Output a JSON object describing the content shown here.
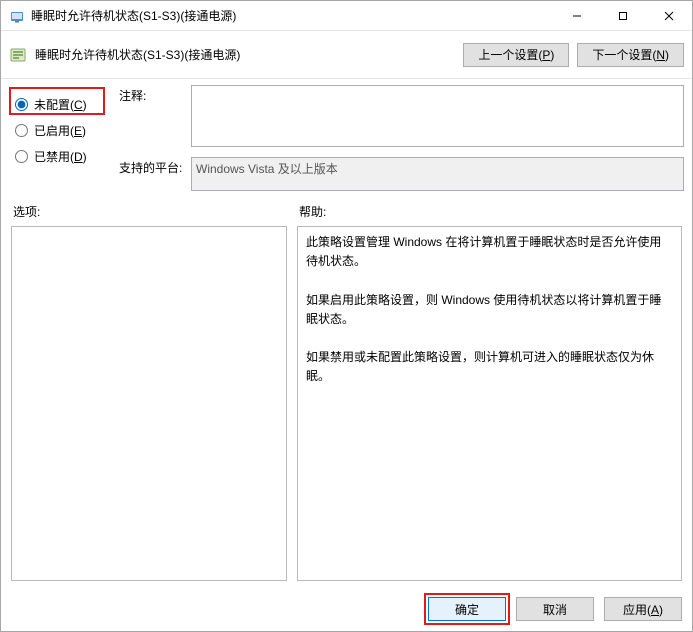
{
  "window": {
    "title": "睡眠时允许待机状态(S1-S3)(接通电源)"
  },
  "header": {
    "policy_title": "睡眠时允许待机状态(S1-S3)(接通电源)",
    "prev_label_pre": "上一个设置(",
    "prev_label_key": "P",
    "prev_label_post": ")",
    "next_label_pre": "下一个设置(",
    "next_label_key": "N",
    "next_label_post": ")"
  },
  "radios": {
    "not_configured_pre": "未配置(",
    "not_configured_key": "C",
    "not_configured_post": ")",
    "enabled_pre": "已启用(",
    "enabled_key": "E",
    "enabled_post": ")",
    "disabled_pre": "已禁用(",
    "disabled_key": "D",
    "disabled_post": ")",
    "selected": "not_configured"
  },
  "fields": {
    "comment_label": "注释:",
    "comment_value": "",
    "supported_label": "支持的平台:",
    "supported_value": "Windows Vista 及以上版本"
  },
  "labels": {
    "options": "选项:",
    "help": "帮助:"
  },
  "help_text": "此策略设置管理 Windows 在将计算机置于睡眠状态时是否允许使用待机状态。\n\n如果启用此策略设置，则 Windows 使用待机状态以将计算机置于睡眠状态。\n\n如果禁用或未配置此策略设置，则计算机可进入的睡眠状态仅为休眠。",
  "buttons": {
    "ok": "确定",
    "cancel": "取消",
    "apply_pre": "应用(",
    "apply_key": "A",
    "apply_post": ")"
  }
}
